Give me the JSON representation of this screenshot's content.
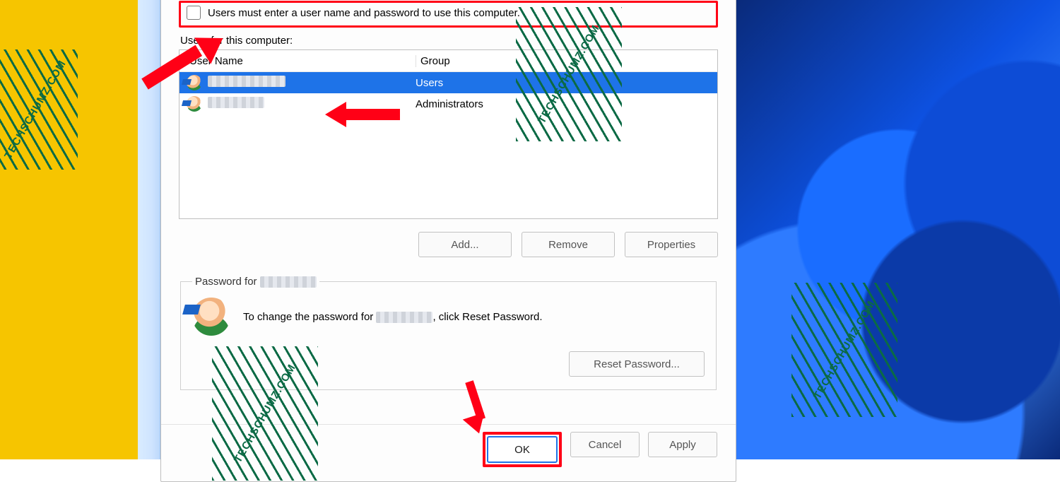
{
  "watermark_text": "TECHSCHUMZ.COM",
  "dialog": {
    "checkbox_label": "Users must enter a user name and password to use this computer.",
    "checkbox_checked": false,
    "users_for_label": "Users for this computer:",
    "columns": {
      "name": "User Name",
      "group": "Group"
    },
    "rows": [
      {
        "group": "Users",
        "selected": true
      },
      {
        "group": "Administrators",
        "selected": false
      }
    ],
    "buttons": {
      "add": "Add...",
      "remove": "Remove",
      "properties": "Properties"
    },
    "password_group": {
      "legend_prefix": "Password for ",
      "text_prefix": "To change the password for ",
      "text_suffix": ", click Reset Password.",
      "reset_btn": "Reset Password..."
    },
    "footer": {
      "ok": "OK",
      "cancel": "Cancel",
      "apply": "Apply"
    }
  }
}
